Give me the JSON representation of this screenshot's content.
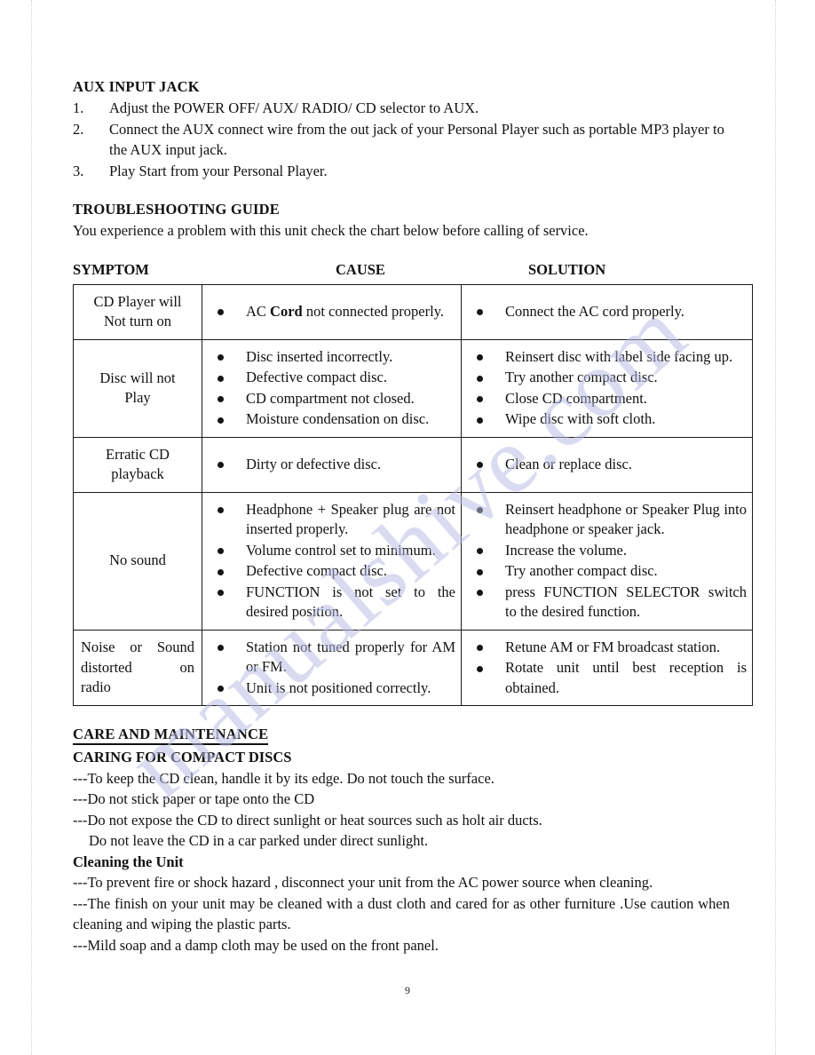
{
  "page": {
    "number": "9",
    "watermark": "manualshive.com"
  },
  "aux_section": {
    "heading": "AUX INPUT JACK",
    "steps": [
      {
        "num": "1.",
        "text": "Adjust the POWER OFF/ AUX/ RADIO/ CD selector to AUX."
      },
      {
        "num": "2.",
        "text": "Connect the AUX connect wire from the out jack of your Personal Player such as portable MP3 player to the AUX input jack."
      },
      {
        "num": "3.",
        "text": "Play Start from your Personal Player."
      }
    ]
  },
  "troubleshooting": {
    "heading": "TROUBLESHOOTING GUIDE",
    "intro": "You experience a problem with this unit check the chart below before calling of service.",
    "columns": {
      "symptom": "SYMPTOM",
      "cause": "CAUSE",
      "solution": "SOLUTION"
    },
    "rows": [
      {
        "symptom_lines": [
          "CD Player will",
          "Not turn on"
        ],
        "causes_pre": [
          "AC "
        ],
        "causes": [
          "AC Cord not connected properly."
        ],
        "cause_bold": "Cord",
        "cause_head": "AC ",
        "cause_tail": " not connected properly.",
        "solutions": [
          "Connect the AC cord properly."
        ]
      },
      {
        "symptom_lines": [
          "Disc will not",
          "Play"
        ],
        "causes": [
          "Disc inserted incorrectly.",
          "Defective compact disc.",
          "CD compartment not closed.",
          "Moisture condensation on disc."
        ],
        "solutions": [
          "Reinsert disc with label side facing up.",
          "Try another compact disc.",
          "Close CD compartment.",
          "Wipe disc with soft cloth."
        ]
      },
      {
        "symptom_lines": [
          "Erratic CD",
          "playback"
        ],
        "causes": [
          "Dirty or defective disc."
        ],
        "solutions": [
          "Clean or replace disc."
        ]
      },
      {
        "symptom_lines": [
          "No sound"
        ],
        "causes": [
          "Headphone + Speaker plug are not inserted properly.",
          "Volume control set to minimum.",
          "Defective compact disc.",
          "FUNCTION is not set to the desired position."
        ],
        "solutions": [
          "Reinsert headphone or Speaker Plug into headphone or speaker jack.",
          "Increase the volume.",
          "Try another compact disc.",
          "press FUNCTION SELECTOR switch to the desired function."
        ]
      },
      {
        "symptom_lines": [
          "Noise or Sound",
          "distorted on",
          "radio"
        ],
        "causes": [
          "Station not tuned properly for AM or FM.",
          "Unit is not positioned correctly."
        ],
        "solutions": [
          "Retune AM or FM broadcast station.",
          "Rotate unit until best reception is obtained."
        ]
      }
    ]
  },
  "care_section": {
    "heading": "CARE AND MAINTENANCE",
    "subheading": "CARING FOR COMPACT DISCS",
    "disc_lines": [
      "---To keep the CD clean, handle it by its edge. Do not touch the surface.",
      "---Do not stick paper or tape onto the CD",
      "---Do not expose the CD to direct sunlight or heat sources such as holt air ducts."
    ],
    "disc_indent_line": "Do not leave the CD in a car parked under direct sunlight.",
    "cleaning_heading": "Cleaning the Unit",
    "cleaning_lines": [
      "---To prevent fire or shock hazard , disconnect your unit from the AC power source when cleaning.",
      "---The finish on your unit may be cleaned with a dust cloth and cared for as other furniture .Use caution when cleaning and wiping the plastic parts.",
      "---Mild soap and a damp cloth may be used on the front panel."
    ]
  }
}
